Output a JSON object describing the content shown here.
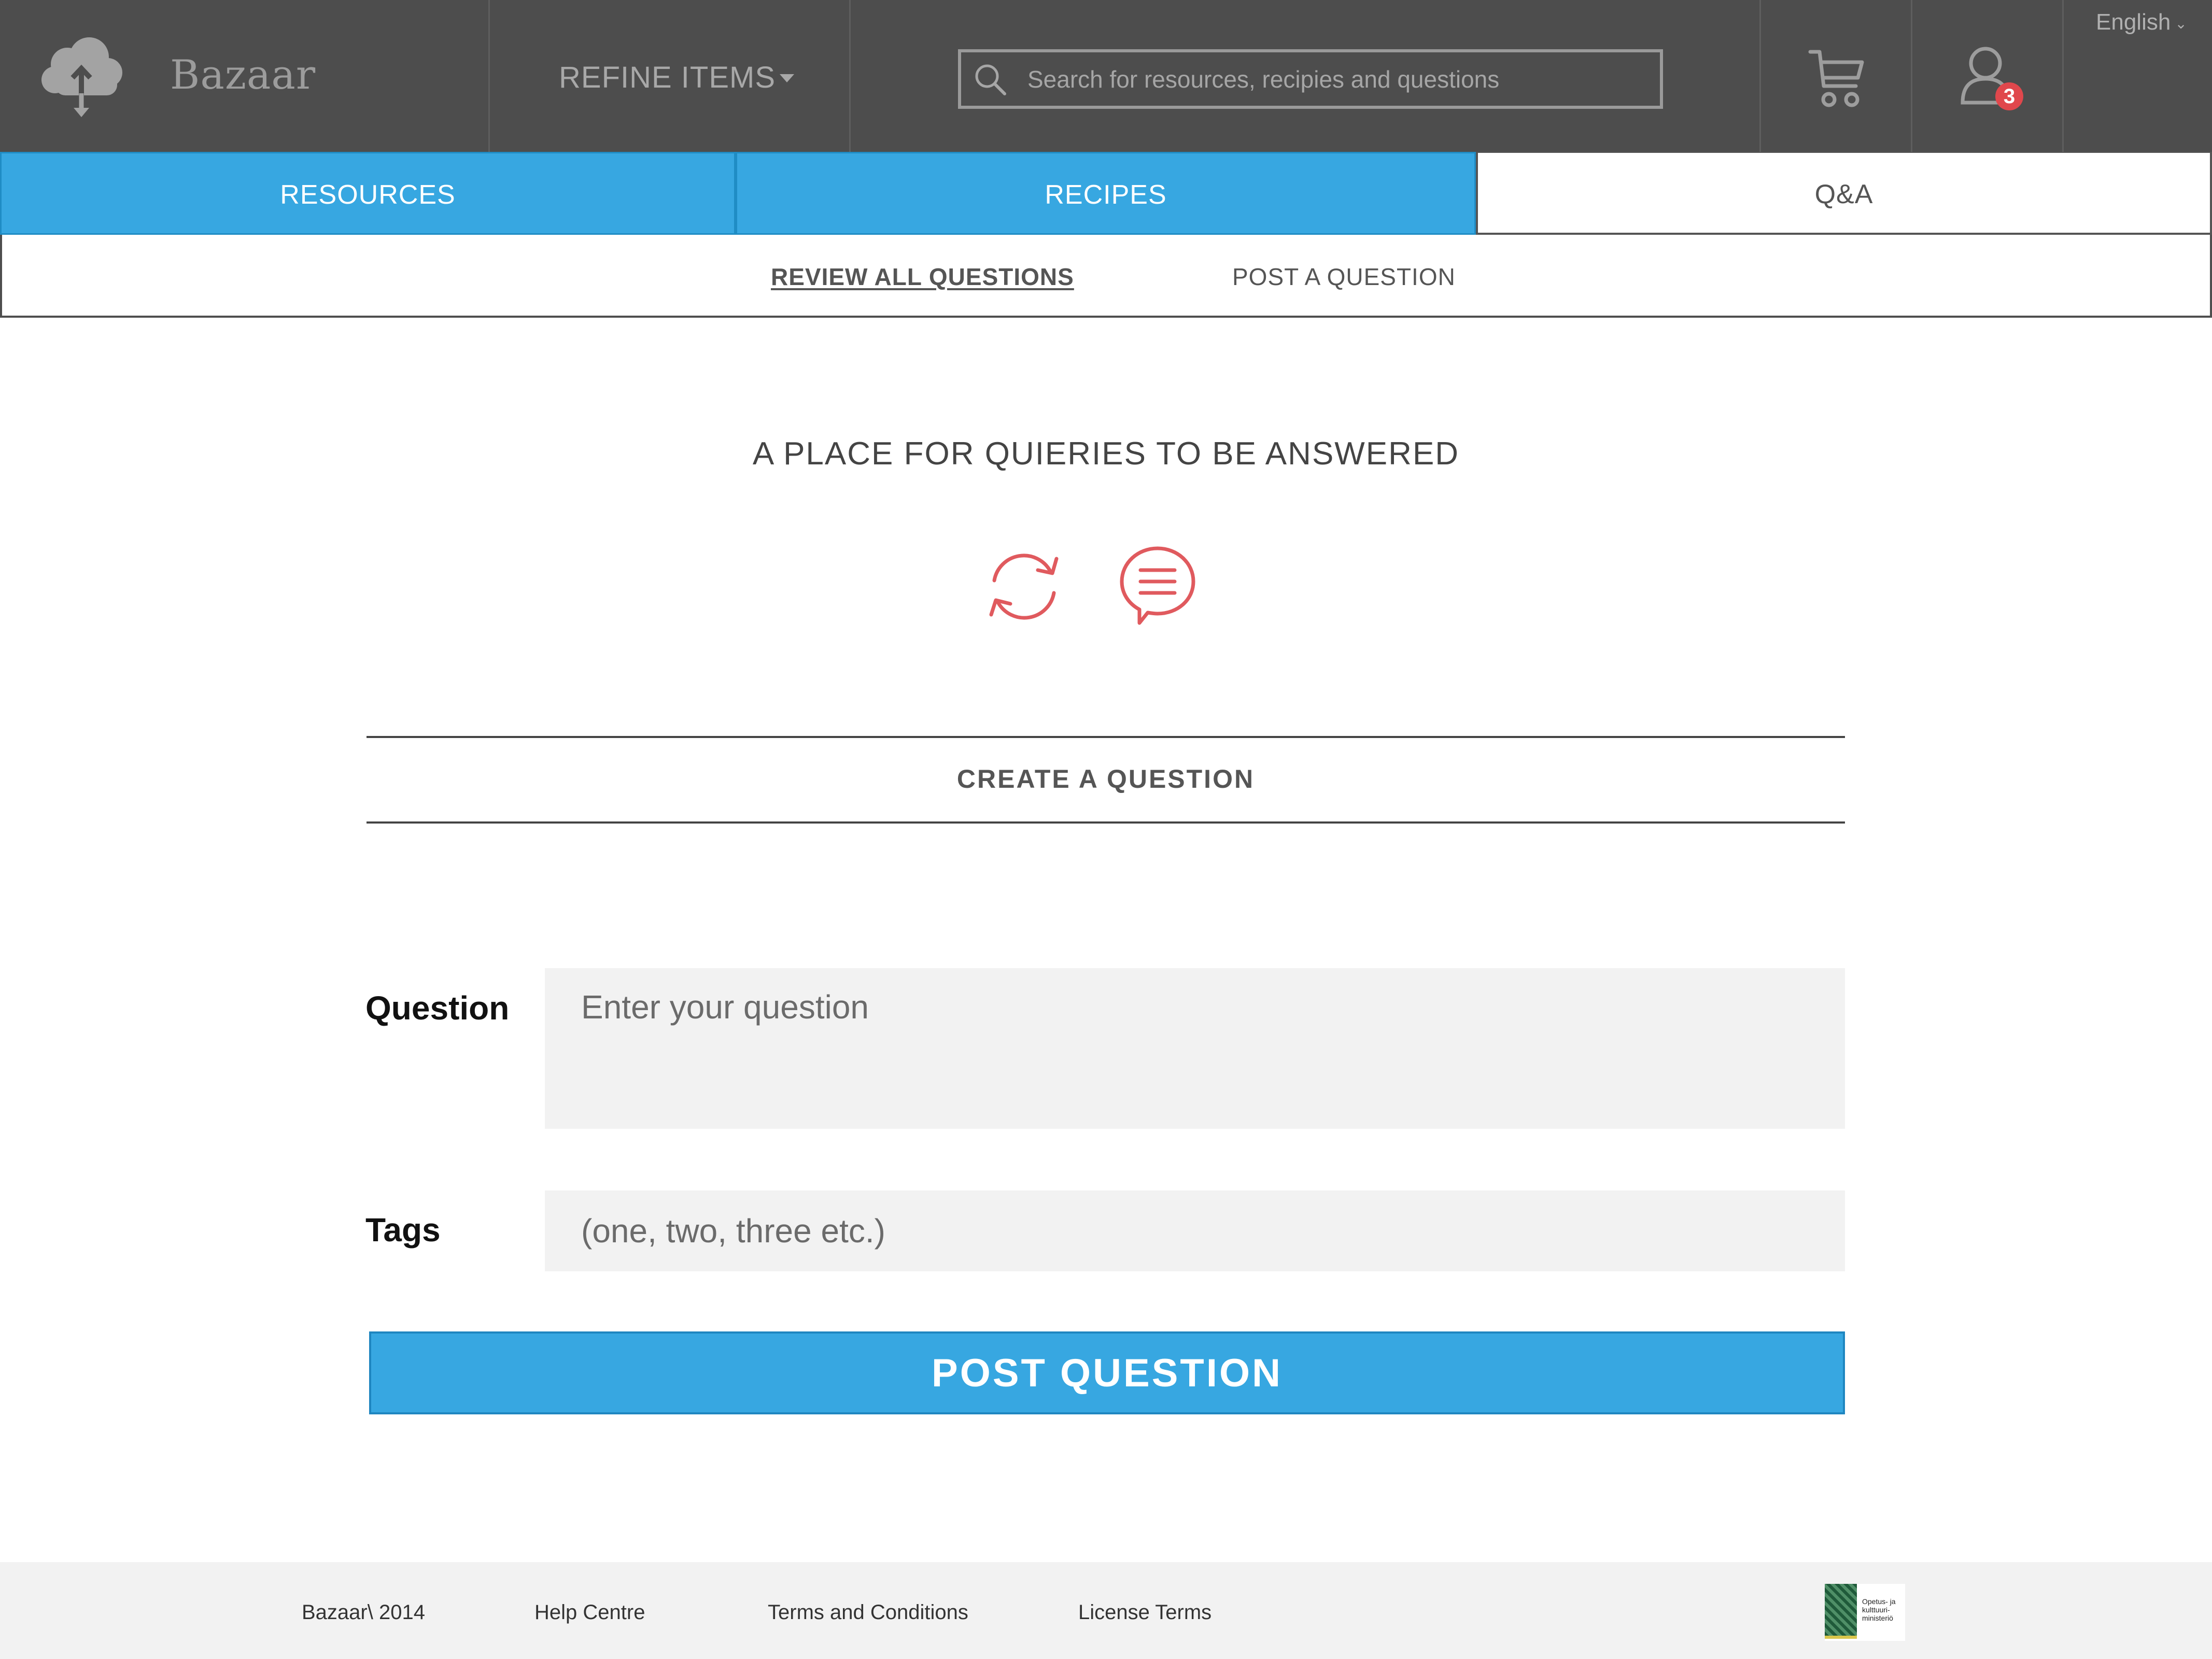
{
  "header": {
    "brand": "Bazaar",
    "refine_label": "REFINE ITEMS",
    "search_placeholder": "Search for resources, recipies and questions",
    "notification_count": "3",
    "language": "English"
  },
  "tabs": [
    {
      "label": "RESOURCES",
      "active": true
    },
    {
      "label": "RECIPES",
      "active": true
    },
    {
      "label": "Q&A",
      "active": false
    }
  ],
  "subnav": {
    "review_all": "REVIEW ALL QUESTIONS",
    "post": "POST A QUESTION"
  },
  "hero": {
    "title": "A PLACE FOR QUIERIES TO BE ANSWERED",
    "icons": [
      "refresh-icon",
      "chat-bubble-icon"
    ],
    "icon_color": "#e05a5e"
  },
  "form": {
    "section_title": "CREATE A QUESTION",
    "question_label": "Question",
    "question_placeholder": "Enter your question",
    "tags_label": "Tags",
    "tags_placeholder": "(one, two, three etc.)",
    "submit_label": "POST QUESTION"
  },
  "footer": {
    "copyright": "Bazaar\\ 2014",
    "help": "Help Centre",
    "terms": "Terms and Conditions",
    "license": "License Terms",
    "ministry_logo_text": "Opetus- ja kulttuuri-ministeriö"
  },
  "colors": {
    "header_bg": "#4d4d4d",
    "accent_blue": "#37a7e1",
    "badge_red": "#e0474c",
    "footer_bg": "#f2f2f2"
  }
}
